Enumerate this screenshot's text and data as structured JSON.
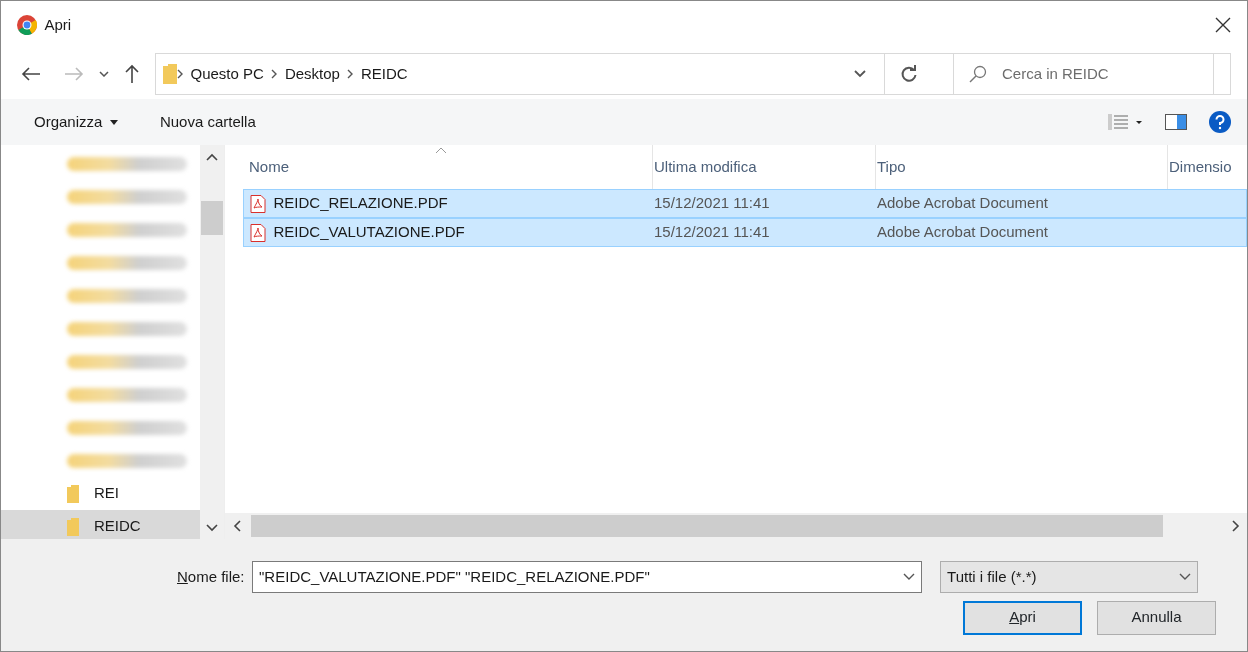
{
  "window": {
    "title": "Apri"
  },
  "breadcrumb": [
    "Questo PC",
    "Desktop",
    "REIDC"
  ],
  "search": {
    "placeholder": "Cerca in REIDC"
  },
  "toolbar": {
    "organize": "Organizza",
    "new_folder": "Nuova cartella"
  },
  "sidebar": {
    "items": [
      {
        "kind": "blurred",
        "selected": false
      },
      {
        "kind": "blurred",
        "selected": false
      },
      {
        "kind": "blurred",
        "selected": false
      },
      {
        "kind": "blurred",
        "selected": false
      },
      {
        "kind": "blurred",
        "selected": false
      },
      {
        "kind": "blurred",
        "selected": false
      },
      {
        "kind": "blurred",
        "selected": false
      },
      {
        "kind": "blurred",
        "selected": false
      },
      {
        "kind": "blurred",
        "selected": false
      },
      {
        "kind": "blurred",
        "selected": false
      },
      {
        "kind": "folder",
        "label": "REI",
        "selected": false
      },
      {
        "kind": "folder",
        "label": "REIDC",
        "selected": true
      }
    ]
  },
  "table": {
    "columns": [
      "Nome",
      "Ultima modifica",
      "Tipo",
      "Dimensio"
    ],
    "rows": [
      {
        "name": "REIDC_RELAZIONE.PDF",
        "modified": "15/12/2021 11:41",
        "type": "Adobe Acrobat Document",
        "selected": true
      },
      {
        "name": "REIDC_VALUTAZIONE.PDF",
        "modified": "15/12/2021 11:41",
        "type": "Adobe Acrobat Document",
        "selected": true
      }
    ]
  },
  "filename": {
    "label": "Nome file:",
    "mnemonic": true,
    "value": "\"REIDC_VALUTAZIONE.PDF\" \"REIDC_RELAZIONE.PDF\""
  },
  "filter": {
    "value": "Tutti i file (*.*)"
  },
  "buttons": [
    {
      "label": "Apri",
      "mnemonic": true,
      "default": true
    },
    {
      "label": "Annulla",
      "default": false
    }
  ]
}
